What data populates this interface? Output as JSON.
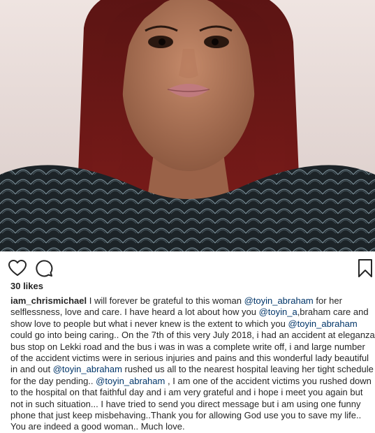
{
  "post": {
    "image_alt": "Portrait photo",
    "likes": "30 likes",
    "icons": {
      "like": "heart-icon",
      "comment": "comment-icon",
      "save": "bookmark-icon"
    },
    "caption": {
      "username": "iam_chrismichael",
      "segments": [
        {
          "type": "text",
          "value": " I will forever be grateful to this woman "
        },
        {
          "type": "mention",
          "value": "@toyin_abraham"
        },
        {
          "type": "text",
          "value": " for her selflessness, love and care. I have heard a lot about how you "
        },
        {
          "type": "mention",
          "value": "@toyin_a"
        },
        {
          "type": "text",
          "value": ",braham care and show love to people but what i never knew is the extent to which you "
        },
        {
          "type": "mention",
          "value": "@toyin_abraham"
        },
        {
          "type": "text",
          "value": " could go into being caring.. On the 7th of this very July 2018, i had an accident at eleganza bus stop on Lekki road and the bus i was in was a complete write off, i and large number of the accident victims were in serious injuries and pains and this wonderful lady beautiful in and out "
        },
        {
          "type": "mention",
          "value": "@toyin_abraham"
        },
        {
          "type": "text",
          "value": " rushed us all to the nearest hospital leaving her tight schedule for the day pending.. "
        },
        {
          "type": "mention",
          "value": "@toyin_abraham"
        },
        {
          "type": "text",
          "value": " , I am one of the accident victims you rushed down to the hospital on that faithful day and i am very grateful and i hope i meet you again but not in such situation... I have tried to send you direct message but i am using one funny phone that just keep misbehaving..Thank you for allowing God use you to save my life.. You are indeed a good woman.. Much love."
        }
      ]
    }
  },
  "colors": {
    "text": "#262626",
    "mention": "#003569",
    "background": "#ffffff"
  }
}
